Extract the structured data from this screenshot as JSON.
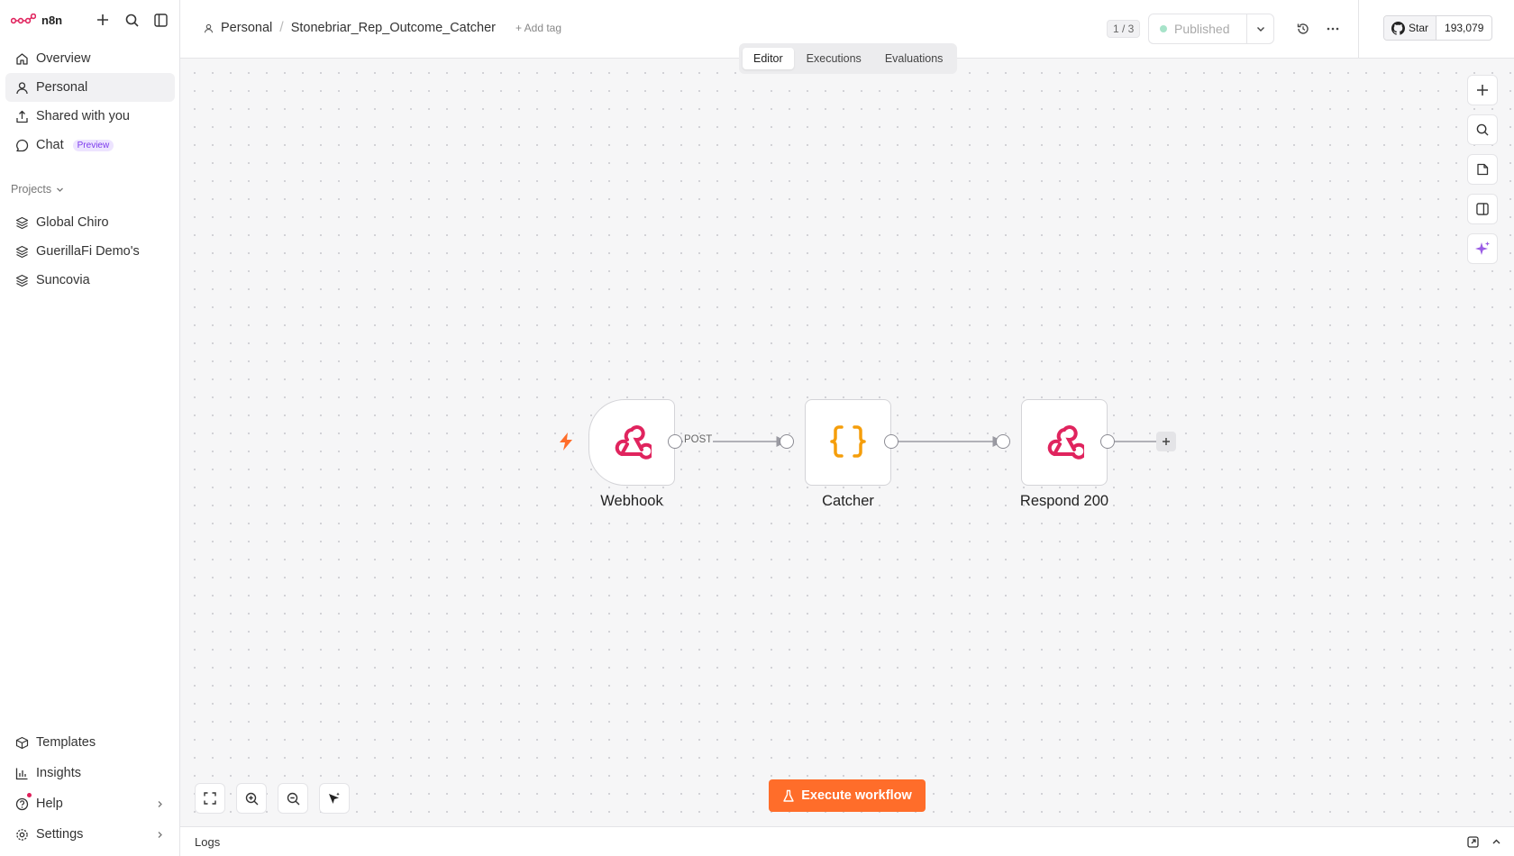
{
  "app": {
    "name": "n8n"
  },
  "sidebar": {
    "nav": [
      {
        "label": "Overview",
        "icon": "home-icon"
      },
      {
        "label": "Personal",
        "icon": "user-icon",
        "active": true
      },
      {
        "label": "Shared with you",
        "icon": "share-icon"
      },
      {
        "label": "Chat",
        "icon": "chat-icon",
        "badge": "Preview"
      }
    ],
    "projects_label": "Projects",
    "projects": [
      {
        "label": "Global Chiro",
        "icon": "layers-icon"
      },
      {
        "label": "GuerillaFi Demo's",
        "icon": "layers-icon"
      },
      {
        "label": "Suncovia",
        "icon": "layers-icon"
      }
    ],
    "bottom": [
      {
        "label": "Templates",
        "icon": "templates-icon"
      },
      {
        "label": "Insights",
        "icon": "insights-icon"
      },
      {
        "label": "Help",
        "icon": "help-icon"
      },
      {
        "label": "Settings",
        "icon": "settings-icon"
      }
    ]
  },
  "header": {
    "breadcrumb_project": "Personal",
    "workflow_name": "Stonebriar_Rep_Outcome_Catcher",
    "add_tag": "+ Add tag",
    "version": "1 / 3",
    "status": "Published",
    "github_star": "Star",
    "github_count": "193,079"
  },
  "tabs": [
    {
      "label": "Editor",
      "active": true
    },
    {
      "label": "Executions"
    },
    {
      "label": "Evaluations"
    }
  ],
  "workflow": {
    "nodes": [
      {
        "name": "Webhook",
        "icon": "webhook-icon",
        "trigger": true
      },
      {
        "name": "Catcher",
        "icon": "code-braces-icon"
      },
      {
        "name": "Respond 200",
        "icon": "webhook-icon"
      }
    ],
    "connection_labels": [
      "POST"
    ]
  },
  "execute_button": "Execute workflow",
  "logs_label": "Logs",
  "colors": {
    "accent": "#ff6d2a",
    "webhook_icon": "#e0245e",
    "code_icon": "#f59e0b",
    "ai_sparkle": "#9b5de5"
  }
}
